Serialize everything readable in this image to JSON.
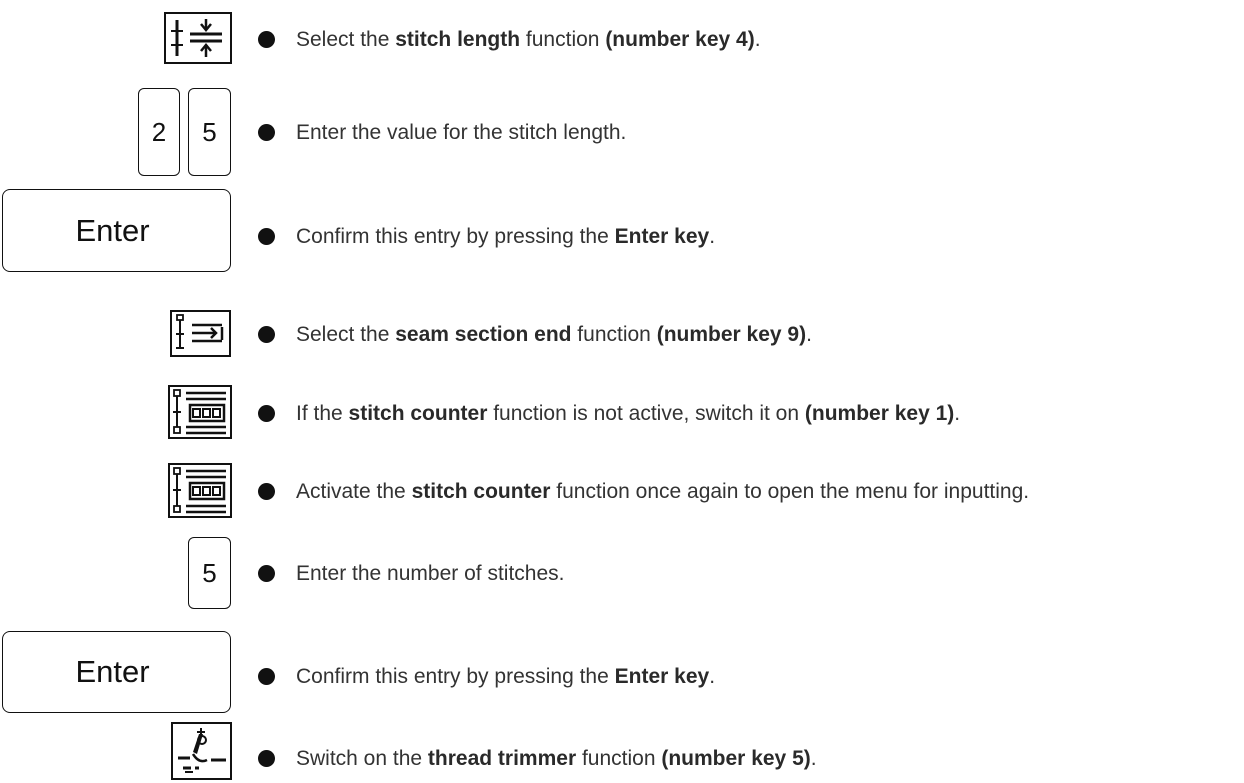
{
  "keys": {
    "num_2": "2",
    "num_5": "5",
    "num_5b": "5",
    "enter_1": "Enter",
    "enter_2": "Enter"
  },
  "icons": {
    "stitch_length": "stitch-length-icon",
    "seam_section_end": "seam-section-end-icon",
    "stitch_counter": "stitch-counter-icon",
    "thread_trimmer": "thread-trimmer-icon"
  },
  "steps": [
    {
      "a": "Select the ",
      "b": "stitch length",
      "c": " function ",
      "d": "(number key 4)",
      "e": "."
    },
    {
      "a": "Enter the value for the stitch length."
    },
    {
      "a": "Confirm this entry by pressing the ",
      "b": "Enter key",
      "c": "."
    },
    {
      "a": "Select the ",
      "b": "seam section end",
      "c": " function ",
      "d": "(number key 9)",
      "e": "."
    },
    {
      "a": "If the ",
      "b": "stitch counter",
      "c": " function is not active, switch it on ",
      "d": "(number key 1)",
      "e": "."
    },
    {
      "a": "Activate the ",
      "b": "stitch counter",
      "c": " function once again to open the menu for inputting."
    },
    {
      "a": "Enter the number of stitches."
    },
    {
      "a": "Confirm this entry by pressing the ",
      "b": "Enter key",
      "c": "."
    },
    {
      "a": "Switch on the ",
      "b": "thread trimmer",
      "c": " function ",
      "d": "(number key 5)",
      "e": "."
    }
  ]
}
